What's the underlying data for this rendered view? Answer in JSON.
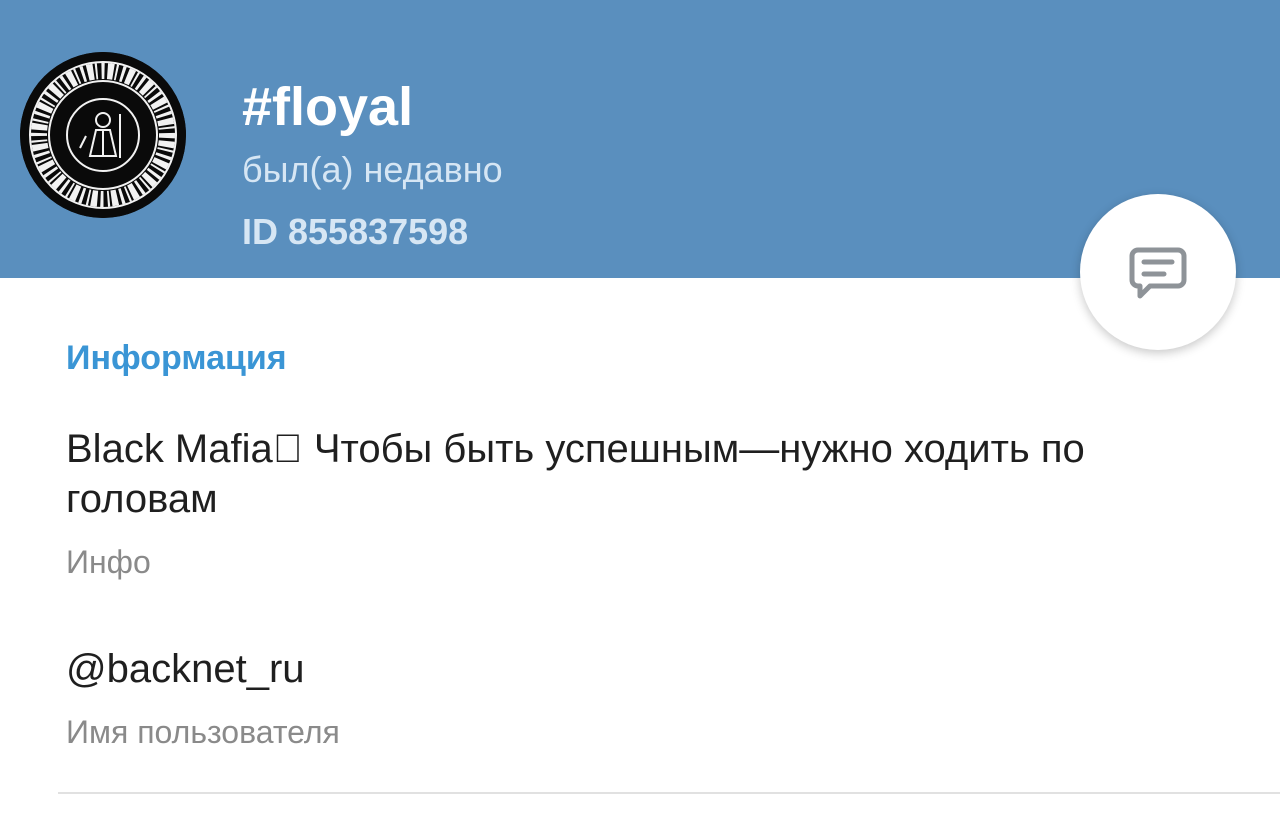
{
  "profile": {
    "name": "#floyal",
    "status": "был(а) недавно",
    "id_text": "ID 855837598"
  },
  "info": {
    "section_title": "Информация",
    "bio": "Black Mafia⃠ Чтобы быть успешным—нужно ходить по головам",
    "bio_label": "Инфо",
    "username": "@backnet_ru",
    "username_label": "Имя пользователя"
  },
  "icons": {
    "avatar": "avatar-seal-image",
    "fab": "message-icon"
  },
  "colors": {
    "header_bg": "#5a8fbe",
    "accent": "#3a95d5",
    "text_primary": "#1f1f1f",
    "text_secondary": "#8a8a8a",
    "header_subtext": "#d6e6f4"
  }
}
